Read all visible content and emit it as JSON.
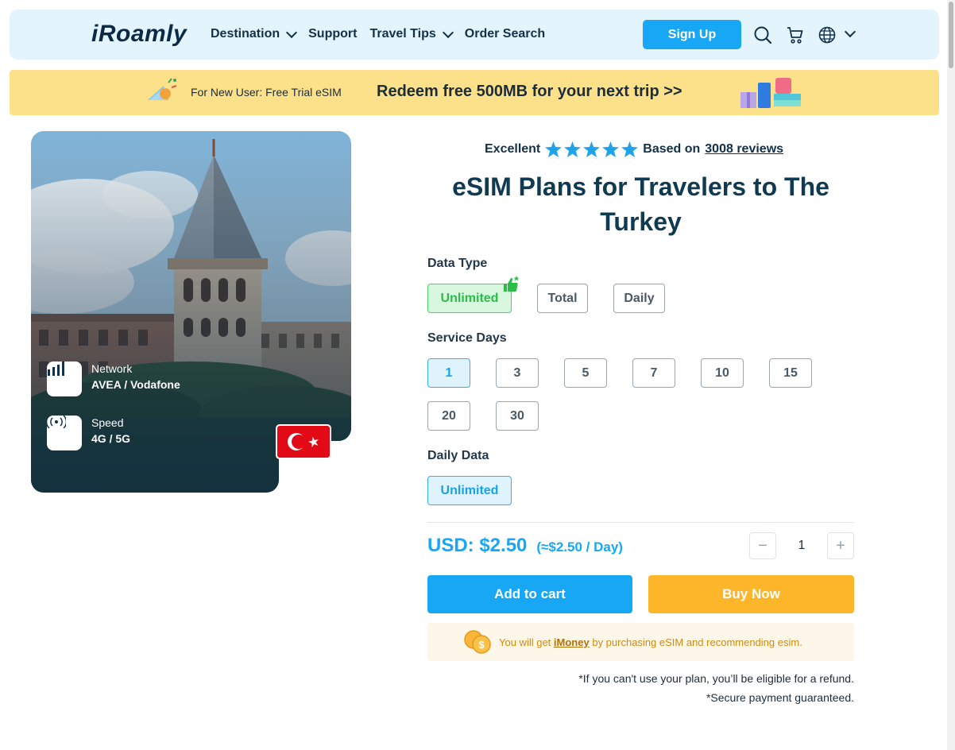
{
  "header": {
    "logo": "iRoamly",
    "nav": [
      {
        "label": "Destination",
        "has_dropdown": true
      },
      {
        "label": "Support",
        "has_dropdown": false
      },
      {
        "label": "Travel Tips",
        "has_dropdown": true
      },
      {
        "label": "Order Search",
        "has_dropdown": false
      }
    ],
    "signup_label": "Sign Up",
    "icons": [
      "search-icon",
      "cart-icon",
      "globe-icon",
      "chevron-down-icon"
    ]
  },
  "promo": {
    "small": "For New User: Free Trial eSIM",
    "big": "Redeem free 500MB for your next trip >>"
  },
  "hero": {
    "network_label": "Network",
    "network_value": "AVEA / Vodafone",
    "speed_label": "Speed",
    "speed_value": "4G / 5G"
  },
  "rating": {
    "word": "Excellent",
    "stars": 5,
    "based_on": "Based on",
    "reviews": "3008 reviews"
  },
  "title": "eSIM Plans for Travelers to The Turkey",
  "data_type": {
    "label": "Data Type",
    "options": [
      "Unlimited",
      "Total",
      "Daily"
    ],
    "selected": "Unlimited"
  },
  "service_days": {
    "label": "Service Days",
    "options": [
      "1",
      "3",
      "5",
      "7",
      "10",
      "15",
      "20",
      "30"
    ],
    "selected": "1"
  },
  "daily_data": {
    "label": "Daily Data",
    "options": [
      "Unlimited"
    ],
    "selected": "Unlimited"
  },
  "price": {
    "main": "USD: $2.50",
    "per_day": "(≈$2.50 / Day)"
  },
  "quantity": {
    "minus": "−",
    "value": "1",
    "plus": "+"
  },
  "buttons": {
    "add_to_cart": "Add to cart",
    "buy_now": "Buy Now"
  },
  "imoney": {
    "prefix": "You will get",
    "link": "iMoney",
    "suffix": "by purchasing eSIM and recommending esim."
  },
  "notes": [
    "*If you can't use your plan, you’ll be eligible for a refund.",
    "*Secure payment guaranteed."
  ],
  "colors": {
    "accent": "#17a7f5",
    "buy": "#fdb52a",
    "header_bg": "#e4f4fd",
    "promo_bg": "#fde08a",
    "selected_green": "#2bbd46"
  }
}
